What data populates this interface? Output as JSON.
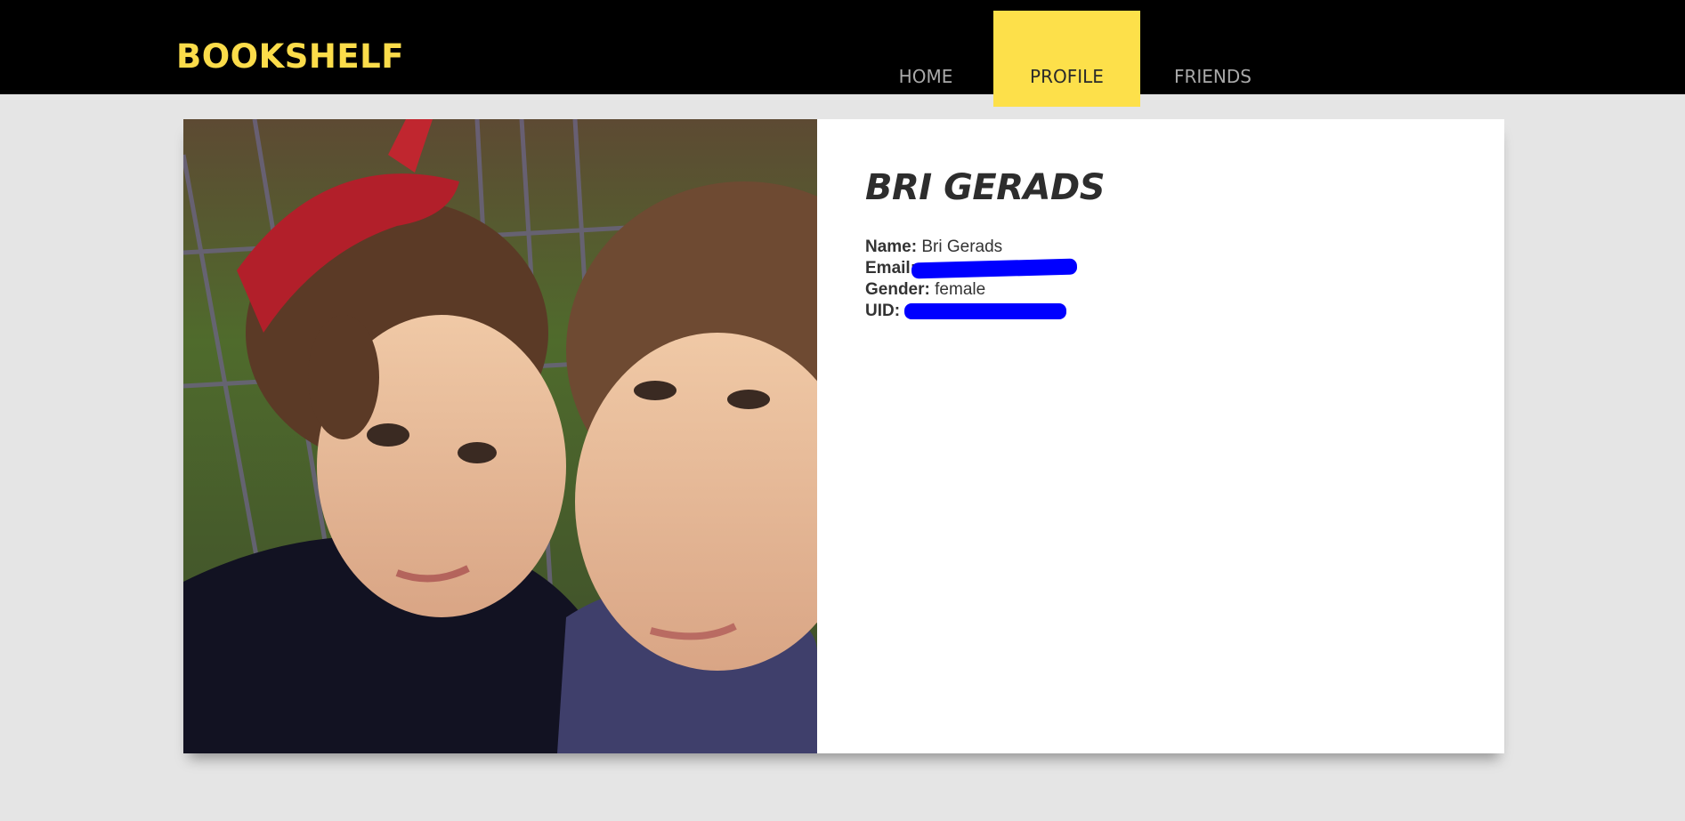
{
  "header": {
    "brand": "BOOKSHELF",
    "nav": [
      {
        "label": "HOME"
      },
      {
        "label": "PROFILE"
      },
      {
        "label": "FRIENDS"
      }
    ]
  },
  "profile": {
    "heading": "BRI GERADS",
    "fields": {
      "name_label": "Name:",
      "name_value": "Bri Gerads",
      "email_label": "Email:",
      "gender_label": "Gender:",
      "gender_value": "female",
      "uid_label": "UID:"
    }
  },
  "colors": {
    "accent": "#fde04a",
    "topbar": "#000000",
    "background": "#e5e5e5",
    "redaction": "#0000ff"
  }
}
